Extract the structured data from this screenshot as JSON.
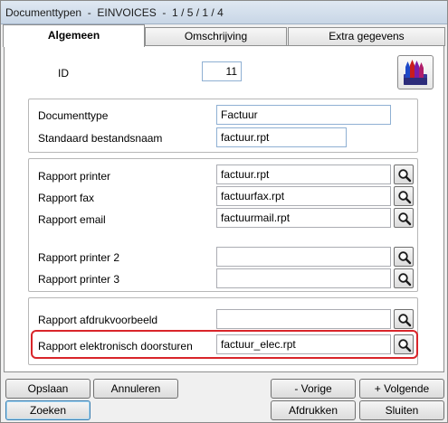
{
  "window": {
    "title": "Documenttypen  -  EINVOICES  -  1 / 5 / 1 / 4"
  },
  "tabs": [
    {
      "label": "Algemeen",
      "active": true
    },
    {
      "label": "Omschrijving",
      "active": false
    },
    {
      "label": "Extra gegevens",
      "active": false
    }
  ],
  "id_field": {
    "label": "ID",
    "value": "11"
  },
  "general": {
    "documenttype_label": "Documenttype",
    "documenttype_value": "Factuur",
    "bestandsnaam_label": "Standaard bestandsnaam",
    "bestandsnaam_value": "factuur.rpt"
  },
  "reports": {
    "printer_label": "Rapport printer",
    "printer_value": "factuur.rpt",
    "fax_label": "Rapport fax",
    "fax_value": "factuurfax.rpt",
    "email_label": "Rapport email",
    "email_value": "factuurmail.rpt",
    "printer2_label": "Rapport printer 2",
    "printer2_value": "",
    "printer3_label": "Rapport printer 3",
    "printer3_value": ""
  },
  "preview": {
    "afdruk_label": "Rapport afdrukvoorbeeld",
    "afdruk_value": "",
    "elektronisch_label": "Rapport elektronisch doorsturen",
    "elektronisch_value": "factuur_elec.rpt"
  },
  "buttons": {
    "opslaan": "Opslaan",
    "annuleren": "Annuleren",
    "zoeken": "Zoeken",
    "vorige": "- Vorige",
    "volgende": "+ Volgende",
    "afdrukken": "Afdrukken",
    "sluiten": "Sluiten"
  },
  "icons": {
    "lookup": "magnifier-icon",
    "logo": "crayons-icon"
  },
  "colors": {
    "highlight": "#d9252a",
    "default_button_border": "#3c7fb1"
  }
}
